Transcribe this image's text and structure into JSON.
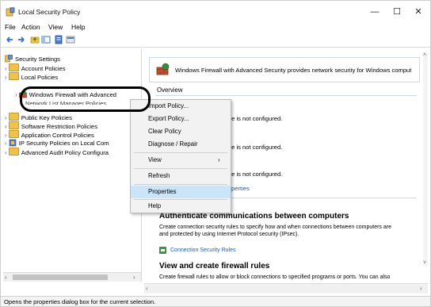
{
  "window": {
    "title": "Local Security Policy",
    "controls": {
      "minimize": "—",
      "maximize": "☐",
      "close": "✕"
    }
  },
  "menubar": {
    "items": [
      "File",
      "Action",
      "View",
      "Help"
    ]
  },
  "toolbar": {
    "icons": [
      "back-icon",
      "forward-icon",
      "up-folder-icon",
      "show-hide-tree-icon",
      "properties-icon",
      "help-icon"
    ]
  },
  "tree": {
    "root": "Security Settings",
    "items": [
      "Account Policies",
      "Local Policies",
      "Windows Firewall with Advanced Security",
      "Network List Manager Policies",
      "Public Key Policies",
      "Software Restriction Policies",
      "Application Control Policies",
      "IP Security Policies on Local Com",
      "Advanced Audit Policy Configura"
    ],
    "selected_label": "Windows Firewall with Advanced"
  },
  "right": {
    "header_text": "Windows Firewall with Advanced Security provides network security for Windows comput",
    "overview_label": "Overview",
    "not_configured_1": "te is not configured.",
    "not_configured_2": "te is not configured.",
    "not_configured_3": "te is not configured.",
    "properties_link": "perties",
    "auth_heading": "Authenticate communications between computers",
    "auth_desc_1": "Create connection security rules to specify how and when connections between computers are",
    "auth_desc_2": "and protected by using Internet Protocol security (IPsec).",
    "connection_rules_link": "Connection Security Rules",
    "view_heading": "View and create firewall rules",
    "view_desc": "Create firewall rules to allow or block connections to specified programs or ports. You can also"
  },
  "context_menu": {
    "items": [
      "Import Policy...",
      "Export Policy...",
      "Clear Policy",
      "Diagnose / Repair",
      "View",
      "Refresh",
      "Properties",
      "Help"
    ],
    "submenu_arrow": "›"
  },
  "statusbar": {
    "text": "Opens the properties dialog box for the current selection."
  }
}
